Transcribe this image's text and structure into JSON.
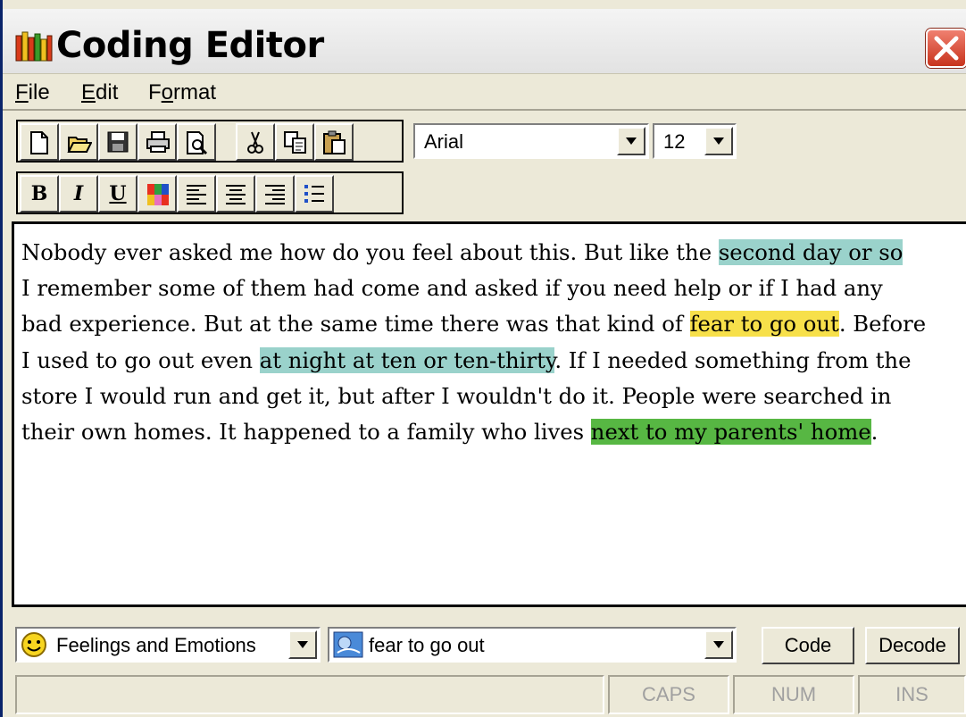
{
  "window": {
    "title": "Coding Editor",
    "close_icon": "close-icon"
  },
  "menu": {
    "items": [
      {
        "label": "File",
        "access_key": "F"
      },
      {
        "label": "Edit",
        "access_key": "E"
      },
      {
        "label": "Format",
        "access_key": "o"
      }
    ]
  },
  "toolbar": {
    "row1_icons": [
      "new-document-icon",
      "open-folder-icon",
      "save-icon",
      "print-icon",
      "print-preview-icon",
      "cut-icon",
      "copy-icon",
      "paste-icon"
    ],
    "row2_icons": [
      "bold-icon",
      "italic-icon",
      "underline-icon",
      "color-icon",
      "align-left-icon",
      "align-center-icon",
      "align-right-icon",
      "bullet-list-icon"
    ],
    "bold_label": "B",
    "italic_label": "I",
    "underline_label": "U",
    "font_name": "Arial",
    "font_size": "12"
  },
  "document": {
    "lines": [
      [
        {
          "text": "Nobody ever asked me how do you feel about this. But like the "
        },
        {
          "text": "second day or so",
          "highlight": "teal"
        }
      ],
      [
        {
          "text": "I remember some of them had come and asked if you need help or if I had any"
        }
      ],
      [
        {
          "text": "bad experience. But at the same time there was that kind of "
        },
        {
          "text": "fear to go out",
          "highlight": "yellow"
        },
        {
          "text": ". Before"
        }
      ],
      [
        {
          "text": "I used to go out even "
        },
        {
          "text": "at night at ten or ten-thirty",
          "highlight": "teal"
        },
        {
          "text": ". If I needed something from the"
        }
      ],
      [
        {
          "text": "store I would run and get it, but after I wouldn't do it. People were searched in"
        }
      ],
      [
        {
          "text": "their own homes. It happened to a family who lives "
        },
        {
          "text": "next to my parents' home",
          "highlight": "green"
        },
        {
          "text": "."
        }
      ]
    ],
    "highlight_colors": {
      "teal": "#9ad2cb",
      "yellow": "#f7e04a",
      "green": "#57b743"
    }
  },
  "coding": {
    "category": "Feelings and Emotions",
    "category_icon": "smiley-icon",
    "code": "fear to go out",
    "code_icon": "code-icon",
    "code_button": "Code",
    "decode_button": "Decode"
  },
  "status": {
    "caps": "CAPS",
    "num": "NUM",
    "ins": "INS"
  }
}
